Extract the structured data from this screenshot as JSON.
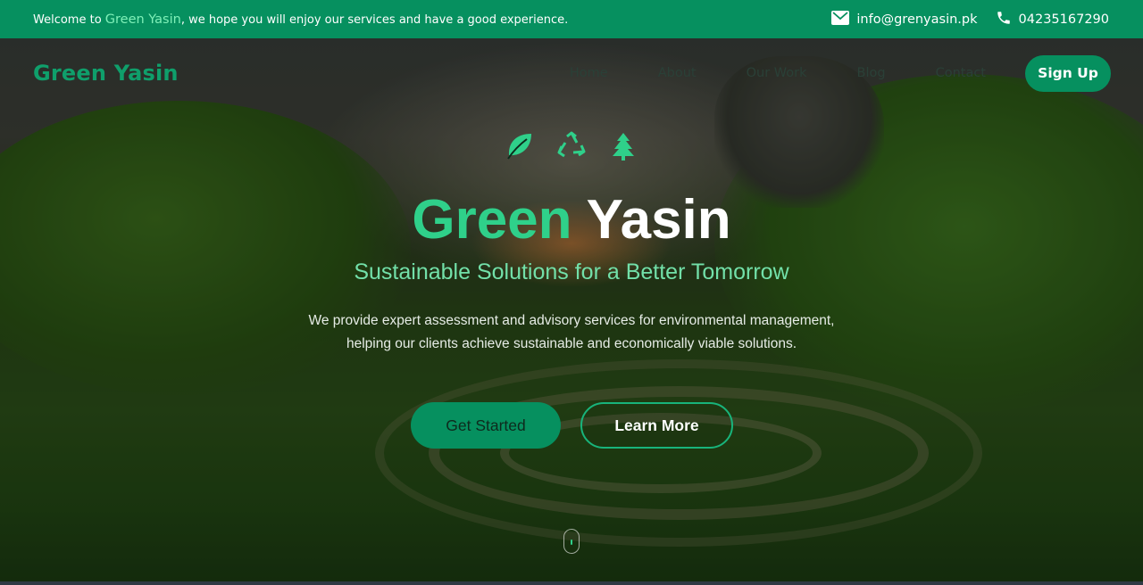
{
  "topbar": {
    "welcome_prefix": "Welcome to ",
    "welcome_brand": "Green Yasin",
    "welcome_suffix": ", we hope you will enjoy our services and have a good experience.",
    "email": "info@grenyasin.pk",
    "phone": "04235167290",
    "email_icon": "mail-icon",
    "phone_icon": "phone-icon"
  },
  "nav": {
    "logo": "Green Yasin",
    "links": [
      "Home",
      "About",
      "Our Work",
      "Blog",
      "Contact"
    ],
    "signup_label": "Sign Up"
  },
  "hero": {
    "icons": [
      "leaf-icon",
      "recycle-icon",
      "tree-icon"
    ],
    "title_part1": "Green",
    "title_part2": "Yasin",
    "subtitle": "Sustainable Solutions for a Better Tomorrow",
    "description": "We provide expert assessment and advisory services for environmental management, helping our clients achieve sustainable and economically viable solutions.",
    "primary_button": "Get Started",
    "secondary_button": "Learn More",
    "scroll_indicator": "mouse-scroll-icon"
  },
  "colors": {
    "brand_green": "#06905f",
    "accent_green": "#2fd08a",
    "subtitle_green": "#72e0a9"
  }
}
